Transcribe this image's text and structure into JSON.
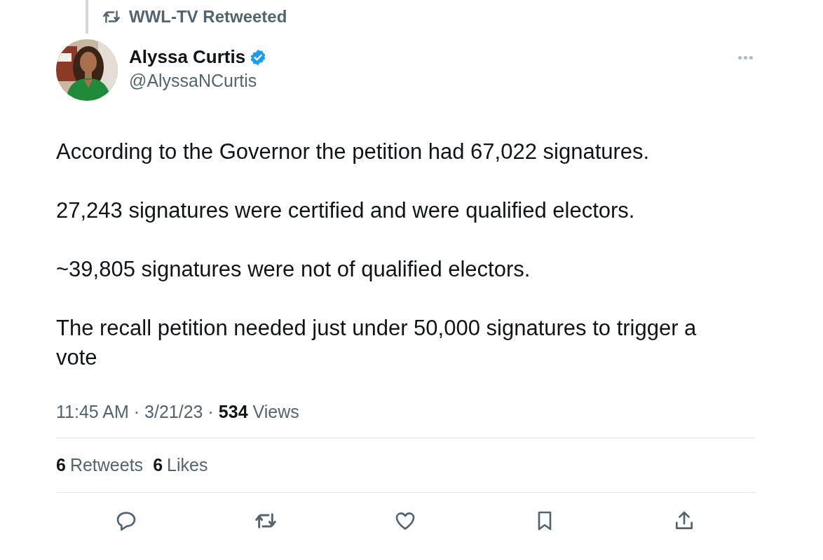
{
  "social_context": {
    "kind": "retweet",
    "text": "WWL-TV Retweeted"
  },
  "author": {
    "name": "Alyssa Curtis",
    "verified": true,
    "handle": "@AlyssaNCurtis"
  },
  "paragraphs": [
    "According to the Governor the petition had 67,022 signatures.",
    "27,243 signatures were certified and were qualified electors.",
    "~39,805 signatures were not of qualified electors.",
    "The recall petition needed just under 50,000 signatures to trigger a vote"
  ],
  "meta": [
    {
      "text": "11:45 AM",
      "bold": false
    },
    {
      "text": "·",
      "bold": false
    },
    {
      "text": "3/21/23",
      "bold": false
    },
    {
      "text": "·",
      "bold": false
    },
    {
      "text": "534",
      "bold": true
    },
    {
      "text": "Views",
      "bold": false
    }
  ],
  "stats": [
    {
      "count": "6",
      "label": "Retweets"
    },
    {
      "count": "6",
      "label": "Likes"
    }
  ],
  "actions": [
    {
      "kind": "reply"
    },
    {
      "kind": "retweet"
    },
    {
      "kind": "like"
    },
    {
      "kind": "bookmark"
    },
    {
      "kind": "share"
    }
  ]
}
